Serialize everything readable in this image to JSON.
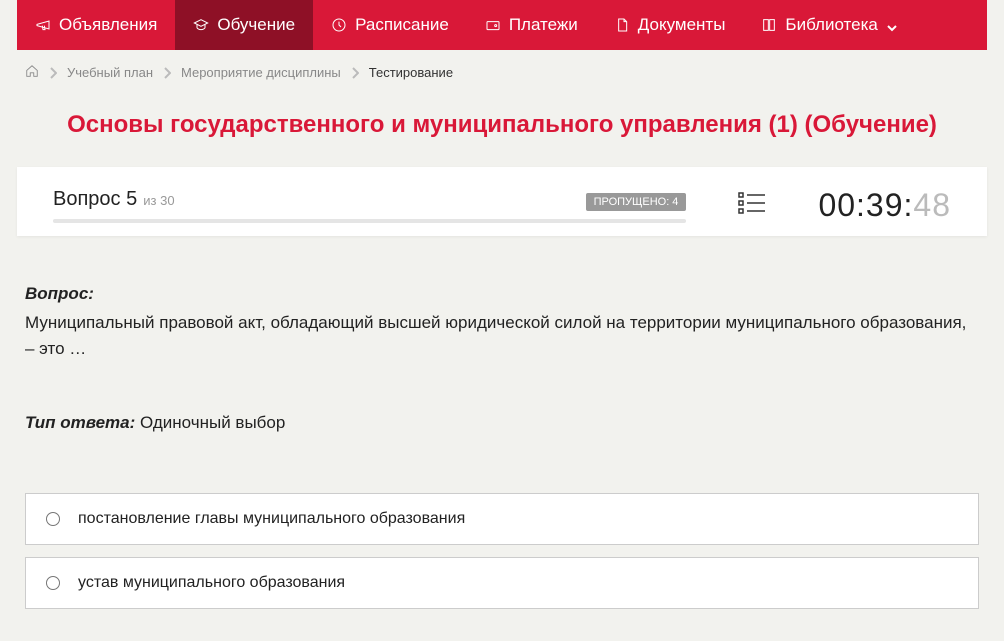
{
  "nav": {
    "items": [
      {
        "label": "Объявления",
        "icon": "megaphone"
      },
      {
        "label": "Обучение",
        "icon": "academic-cap",
        "active": true
      },
      {
        "label": "Расписание",
        "icon": "clock"
      },
      {
        "label": "Платежи",
        "icon": "wallet"
      },
      {
        "label": "Документы",
        "icon": "document"
      },
      {
        "label": "Библиотека",
        "icon": "book",
        "dropdown": true
      }
    ]
  },
  "breadcrumb": {
    "items": [
      {
        "label": "Учебный план"
      },
      {
        "label": "Мероприятие дисциплины"
      }
    ],
    "current": "Тестирование"
  },
  "page_title": "Основы государственного и муниципального управления (1) (Обучение)",
  "status": {
    "question_label": "Вопрос",
    "question_current": "5",
    "question_total_prefix": "из",
    "question_total": "30",
    "skipped_label": "ПРОПУЩЕНО: 4",
    "progress_percent": 0,
    "timer_main": "00:39:",
    "timer_seconds": "48"
  },
  "question": {
    "label": "Вопрос:",
    "text": "Муниципальный правовой акт, обладающий высшей юридической силой на территории муниципального образования, – это …",
    "answer_type_label": "Тип ответа:",
    "answer_type": "Одиночный выбор"
  },
  "options": [
    {
      "text": "постановление главы муниципального образования"
    },
    {
      "text": "устав муниципального образования"
    }
  ]
}
